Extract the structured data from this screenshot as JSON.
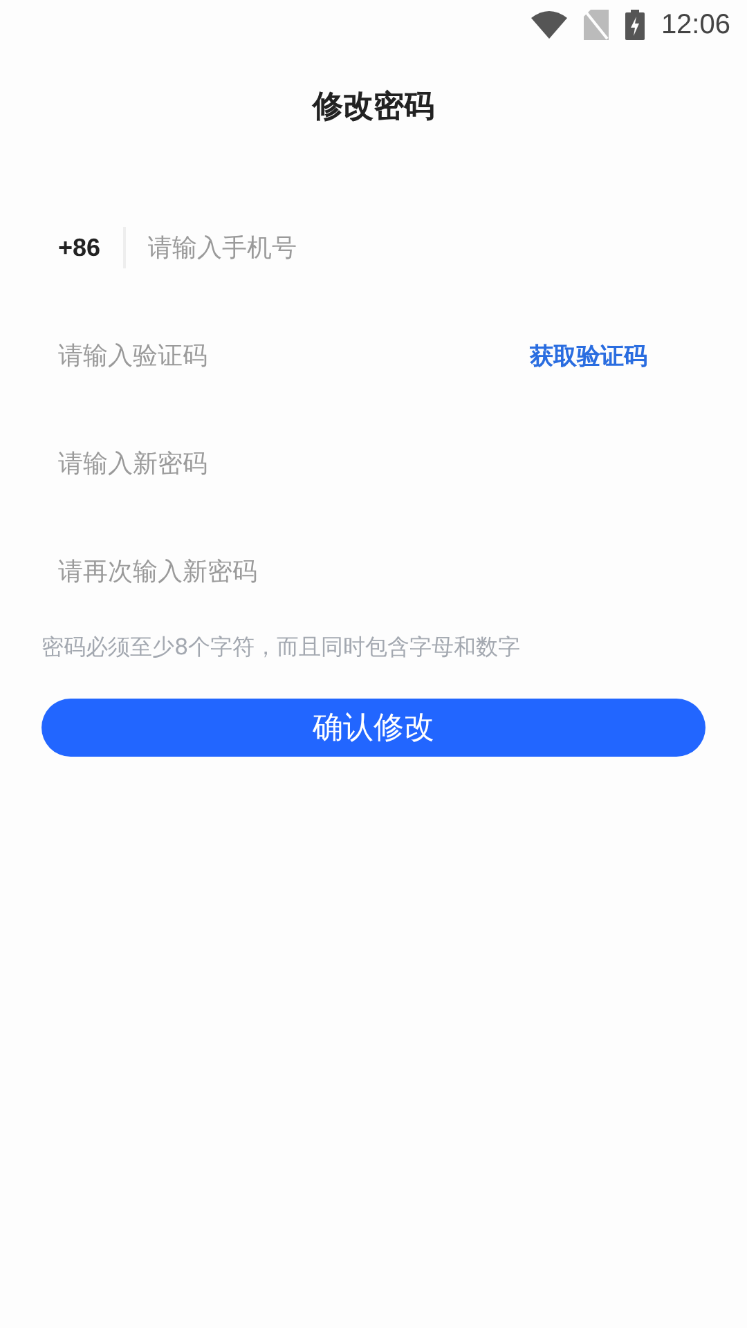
{
  "status_bar": {
    "time": "12:06"
  },
  "title": "修改密码",
  "fields": [
    {
      "kind": "phone",
      "prefix": "+86",
      "placeholder": "请输入手机号"
    },
    {
      "kind": "code",
      "placeholder": "请输入验证码",
      "action": "获取验证码"
    },
    {
      "kind": "plain",
      "placeholder": "请输入新密码"
    },
    {
      "kind": "plain",
      "placeholder": "请再次输入新密码"
    }
  ],
  "hint": "密码必须至少8个字符，而且同时包含字母和数字",
  "submit": "确认修改"
}
